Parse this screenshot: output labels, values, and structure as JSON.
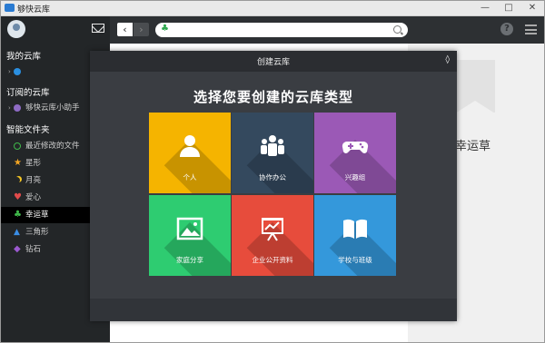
{
  "window": {
    "title": "够快云库",
    "controls": [
      "—",
      "□",
      "✕"
    ]
  },
  "sidebar": {
    "sections": [
      {
        "title": "我的云库",
        "items": [
          {
            "label": "",
            "icon": "cloud-drive-icon"
          }
        ]
      },
      {
        "title": "订阅的云库",
        "items": [
          {
            "label": "够快云库小助手",
            "icon": "assistant-icon"
          }
        ]
      },
      {
        "title": "智能文件夹",
        "items": [
          {
            "label": "最近修改的文件",
            "icon": "clock-icon",
            "color": "#3fb84a"
          },
          {
            "label": "星形",
            "icon": "star-icon",
            "color": "#f5a623"
          },
          {
            "label": "月亮",
            "icon": "moon-icon",
            "color": "#f5c623"
          },
          {
            "label": "爱心",
            "icon": "heart-icon",
            "color": "#e24b4b"
          },
          {
            "label": "幸运草",
            "icon": "clover-icon",
            "color": "#3fb84a",
            "active": true
          },
          {
            "label": "三角形",
            "icon": "triangle-icon",
            "color": "#3a8ee6"
          },
          {
            "label": "钻石",
            "icon": "diamond-icon",
            "color": "#9b59d0"
          }
        ]
      }
    ]
  },
  "toolbar": {
    "address_icon": "♣"
  },
  "right_panel": {
    "title": "幸运草"
  },
  "dialog": {
    "title": "创建云库",
    "heading": "选择您要创建的云库类型",
    "tiles": [
      {
        "label": "个人",
        "icon": "person-icon",
        "color": "#f5b400"
      },
      {
        "label": "协作办公",
        "icon": "team-icon",
        "color": "#34495e"
      },
      {
        "label": "兴趣组",
        "icon": "gamepad-icon",
        "color": "#9b59b6"
      },
      {
        "label": "家庭分享",
        "icon": "picture-icon",
        "color": "#2ecc71"
      },
      {
        "label": "企业公开资料",
        "icon": "presentation-icon",
        "color": "#e74c3c"
      },
      {
        "label": "学校与班级",
        "icon": "book-icon",
        "color": "#3498db"
      }
    ]
  }
}
